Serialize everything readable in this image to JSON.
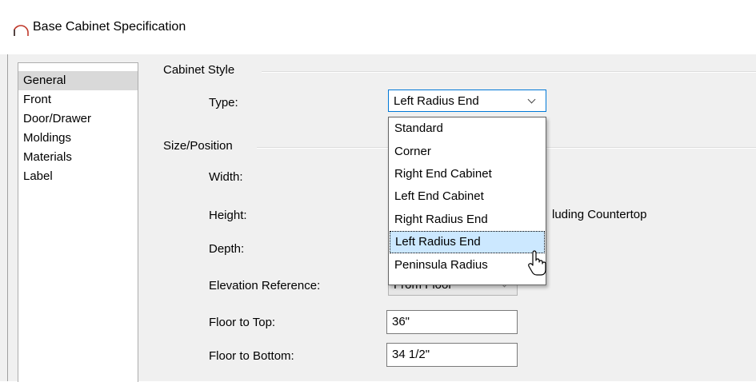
{
  "window": {
    "title": "Base Cabinet Specification",
    "icon": "cabinet-arc-icon"
  },
  "nav": {
    "items": [
      {
        "label": "General",
        "selected": true
      },
      {
        "label": "Front",
        "selected": false
      },
      {
        "label": "Door/Drawer",
        "selected": false
      },
      {
        "label": "Moldings",
        "selected": false
      },
      {
        "label": "Materials",
        "selected": false
      },
      {
        "label": "Label",
        "selected": false
      }
    ]
  },
  "cabinet_style": {
    "group_label": "Cabinet Style",
    "type_label": "Type:",
    "type_value": "Left Radius End",
    "options": [
      "Standard",
      "Corner",
      "Right End Cabinet",
      "Left End Cabinet",
      "Right Radius End",
      "Left Radius End",
      "Peninsula Radius"
    ],
    "highlighted_option": "Left Radius End"
  },
  "size_position": {
    "group_label": "Size/Position",
    "width_label": "Width:",
    "height_label": "Height:",
    "height_suffix": "luding Countertop",
    "depth_label": "Depth:",
    "elevation_label": "Elevation Reference:",
    "elevation_value": "From Floor",
    "floor_to_top_label": "Floor to Top:",
    "floor_to_top_value": "36\"",
    "floor_to_bottom_label": "Floor to Bottom:",
    "floor_to_bottom_value": "34 1/2\""
  },
  "colors": {
    "accent": "#0078d7",
    "highlight": "#cce8ff",
    "nav_selected": "#d9d9d9",
    "dialog_bg": "#f0f0f0"
  }
}
